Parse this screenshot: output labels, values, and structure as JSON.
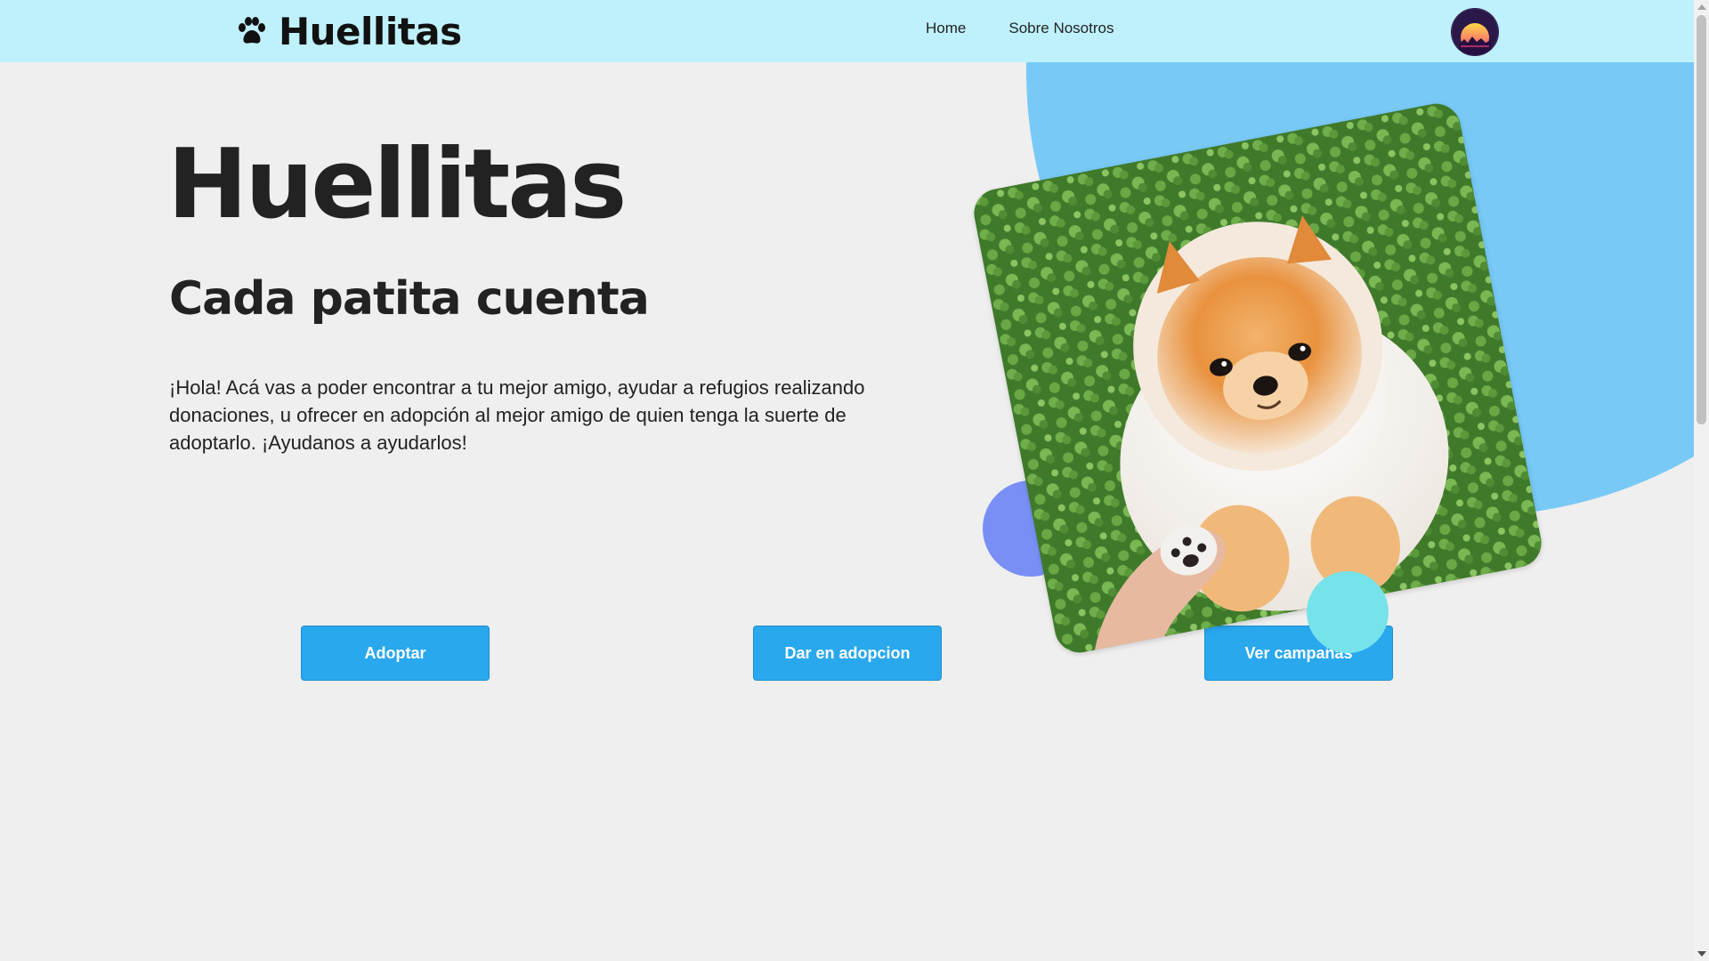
{
  "navbar": {
    "brand": "Huellitas",
    "brand_icon": "paw-icon",
    "links": [
      {
        "label": "Home"
      },
      {
        "label": "Sobre Nosotros"
      }
    ],
    "avatar_icon": "sunset-avatar-icon"
  },
  "hero": {
    "title": "Huellitas",
    "subtitle": "Cada patita cuenta",
    "text": "¡Hola! Acá vas a poder encontrar a tu mejor amigo, ayudar a refugios realizando donaciones, u ofrecer en adopción al mejor amigo de quien tenga la suerte de adoptarlo. ¡Ayudanos a ayudarlos!",
    "image_subject": "pomeranian-puppy-on-grass"
  },
  "buttons": {
    "adoptar": "Adoptar",
    "dar_en_adopcion": "Dar en adopcion",
    "ver_campanas": "Ver campañas"
  },
  "colors": {
    "navbar_bg": "#bff1fc",
    "page_bg": "#efefef",
    "button_bg": "#29a8ee",
    "blob": "#78c9f6",
    "circle_purple": "#7a8ff6",
    "circle_teal": "#76e3ea"
  }
}
